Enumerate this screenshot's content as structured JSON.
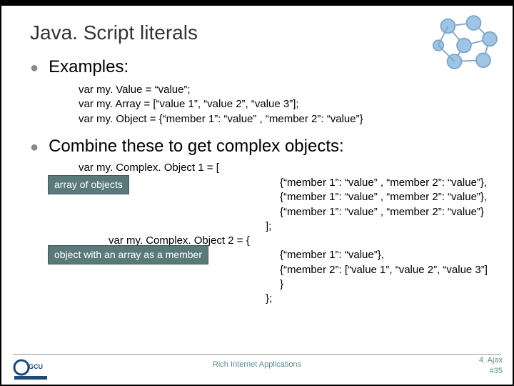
{
  "title": "Java. Script literals",
  "examples": {
    "heading": "Examples:",
    "line1": "var my. Value = “value”;",
    "line2": "var my. Array = [“value 1”, “value 2”, “value 3”];",
    "line3": "var my. Object = {“member 1”: “value” , “member 2”: “value”}"
  },
  "combine": {
    "heading": "Combine these to get complex objects:",
    "c1_decl": "var my. Complex. Object 1 =  [",
    "c1_l1": "{“member 1”: “value” , “member 2”: “value”},",
    "c1_l2": "{“member 1”: “value” , “member 2”: “value”},",
    "c1_l3": "{“member 1”: “value” , “member 2”: “value”}",
    "c1_close": "];",
    "c2_decl": "var my. Complex. Object 2 = {",
    "c2_l1": "{“member 1”: “value”},",
    "c2_l2": "{“member 2”: [“value 1”, “value 2”, “value 3”] }",
    "c2_close": "};",
    "tag1": "array of objects",
    "tag2": "object with an array as a member"
  },
  "footer": {
    "center": "Rich Internet Applications",
    "chapter": "4. Ajax",
    "page": "#35"
  }
}
